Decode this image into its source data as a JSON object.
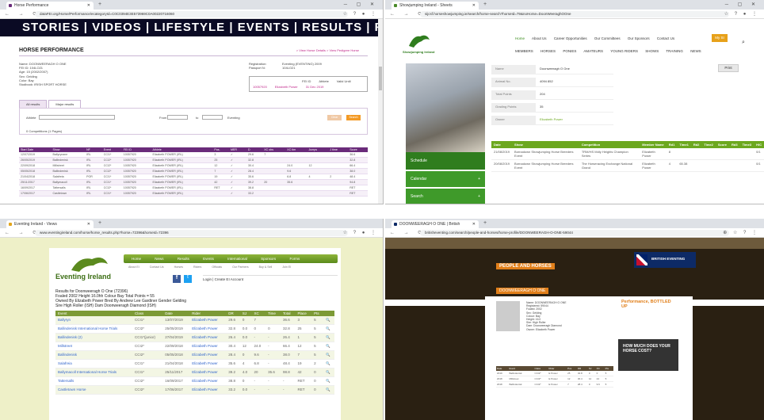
{
  "q1": {
    "tab_title": "Horse Performance",
    "url": "dataFEI.org/Horse/Performance/ecategoryId=C0C0394E3E573969C0A00220716060",
    "banner": "STORIES | VIDEOS | LIFESTYLE | EVENTS | RESULTS | FEI.ORG",
    "page_title": "HORSE PERFORMANCE",
    "links": "> View Horse Details    > View Pedigree Horse",
    "info_left": [
      "Name: DOONWEERAGH O ONE",
      "FEI ID: 104LO21",
      "Age: 15 (2002/2007)",
      "Sex: Gelding",
      "Color: Bay",
      "Studbook: IRISH SPORT HORSE"
    ],
    "info_right_labels": [
      "Registration:",
      "Passport N:"
    ],
    "info_right_values": [
      "Eventing (EVENTING) 2009",
      "104LO21"
    ],
    "box_labels": [
      "FEI ID",
      "Athlete",
      "Valid Until"
    ],
    "box_values": [
      "10057920",
      "Elizabeth Power",
      "31 Dec 2019"
    ],
    "tabs": [
      "All results",
      "Major results"
    ],
    "filter_label": "Athlete",
    "from_label": "From",
    "to_label": "to",
    "checkbox_label": "Eventing",
    "search_btn": "Search",
    "clear_btn": "Clear",
    "results_count": "0 Competitions (1 Pages)",
    "headers": [
      "Start Date",
      "Show",
      "NF",
      "Event",
      "FEI ID",
      "Athlete",
      "Pos.",
      "MER",
      "D",
      "XC obs",
      "XC tim",
      "Jumps",
      "J time",
      "Score"
    ],
    "rows": [
      [
        "12/07/2019",
        "Ballyrynane",
        "IRL",
        "CCI1*",
        "10057920",
        "Elizabeth POWER (IRL)",
        "3",
        "✓",
        "29.6",
        "7",
        "",
        "",
        "",
        "36.6"
      ],
      [
        "26/05/2019",
        "Ballindenisk",
        "IRL",
        "CCI2*",
        "10057920",
        "Elizabeth POWER (IRL)",
        "25",
        "✓",
        "32.8",
        "",
        "",
        "",
        "",
        "32.8"
      ],
      [
        "22/09/2018",
        "Millstreet",
        "IRL",
        "CCI2*",
        "10057920",
        "Elizabeth POWER (IRL)",
        "12",
        "✓",
        "30.4",
        "",
        "24.0",
        "12",
        "",
        "66.4"
      ],
      [
        "05/05/2018",
        "Ballindenisk",
        "IRL",
        "CCI2*",
        "10057920",
        "Elizabeth POWER (IRL)",
        "7",
        "✓",
        "28.4",
        "",
        "9.6",
        "",
        "",
        "38.0"
      ],
      [
        "21/04/2018",
        "Salafreia",
        "POR",
        "CCI1*",
        "10057920",
        "Elizabeth POWER (IRL)",
        "19",
        "✓",
        "35.6",
        "",
        "6.8",
        "4",
        "2",
        "48.4"
      ],
      [
        "25/11/2017",
        "Ballymacoll",
        "IRL",
        "CCI1*",
        "10057920",
        "Elizabeth POWER (IRL)",
        "42",
        "✓",
        "39.2",
        "20",
        "35.6",
        "",
        "",
        "94.8"
      ],
      [
        "16/09/2017",
        "Tattersalls",
        "IRL",
        "CCI2*",
        "10057920",
        "Elizabeth POWER (IRL)",
        "RET",
        "✓",
        "38.8",
        "",
        "",
        "",
        "",
        "RET"
      ],
      [
        "17/06/2017",
        "Castletown",
        "IRL",
        "CCI1*",
        "10057920",
        "Elizabeth POWER (IRL)",
        "",
        "✓",
        "33.2",
        "",
        "",
        "",
        "",
        "RET"
      ]
    ]
  },
  "q2": {
    "tab_title": "Showjumping Ireland - Sheets",
    "url": "sijcsf.horseshowjumping.ie/search/horse-search?horseId=79&noHorse=DoonWeeraghOOne",
    "logo_text": "Showjumping Ireland",
    "nav_top": [
      "Home",
      "About Us",
      "Career Opportunities",
      "Our Committees",
      "Our Sponsors",
      "Contact Us"
    ],
    "my_si": "My SI",
    "nav_main": [
      "MEMBERS",
      "HORSES",
      "PONIES",
      "AMATEURS",
      "YOUNG RIDERS",
      "SHOWS",
      "TRAINING",
      "NEWS"
    ],
    "sidebar": [
      "Schedule",
      "Calendar",
      "Search"
    ],
    "fields": [
      {
        "label": "Name",
        "value": "Doonweeragh O One"
      },
      {
        "label": "Animal No.",
        "value": "4094 852"
      },
      {
        "label": "Total Points",
        "value": "204"
      },
      {
        "label": "Grading Points",
        "value": "35"
      },
      {
        "label": "Owner",
        "value": "Elizabeth Power"
      }
    ],
    "print": "Print",
    "headers": [
      "Date",
      "Show",
      "Competition",
      "Member Name",
      "Rd1",
      "Time1",
      "Rd2",
      "Time2",
      "Score",
      "Rd3",
      "Time3",
      "H/C"
    ],
    "rows": [
      [
        "21/08/2019",
        "Bornadown Showjumping Horse Breeders Event",
        "TRM/HS Mdly Heights Champion Series",
        "Elizabeth Power",
        "8",
        "",
        "",
        "",
        "",
        "",
        "",
        "0/1"
      ],
      [
        "20/08/2019",
        "Bornadown Showjumping Horse Breeders Event",
        "The Horseracing Exchange National Grand",
        "Elizabeth Power",
        "4",
        "65.38",
        "",
        "",
        "",
        "",
        "",
        "0/1"
      ]
    ]
  },
  "q3": {
    "tab_title": "Eventing Ireland - Views",
    "url": "www.eventingireland.com/horse/horse_results.php?horse=72396&horseId=72396",
    "logo_text": "Eventing Ireland",
    "nav": [
      "Home",
      "News",
      "Results",
      "Events",
      "International",
      "Sponsors",
      "Forms"
    ],
    "subnav": [
      "About EI",
      "Contact Us",
      "Horses",
      "Riders",
      "Officials",
      "Our Partners",
      "Buy & Sell",
      "Join EI"
    ],
    "login": "Login   |   Create EI Account",
    "results_lines": [
      "Results for Doonweeragh O One (72396)",
      "Foaled 2002 Height 16.0hh Colour Bay Total Points = 55",
      "Owned By Elizabeth Power Bred By Andrew Lee Gardiner Gender Gelding",
      "Sire High Roller (ISH) Dam Doonweeragh Diamond (ISH)"
    ],
    "headers": [
      "Event",
      "Class",
      "Date",
      "Rider",
      "DR",
      "SJ",
      "XC",
      "Time",
      "Total",
      "Place",
      "Pts",
      ""
    ],
    "rows": [
      [
        "Ballyryn",
        "CCI1*",
        "13/07/2019",
        "Elizabeth Power",
        "29.6",
        "0",
        "7",
        "",
        "36.6",
        "3",
        "5",
        "🔍"
      ],
      [
        "Ballindenisk International Horse Trials",
        "CCI2*",
        "25/05/2019",
        "Elizabeth Power",
        "32.8",
        "0.0",
        "0",
        "0",
        "32.8",
        "25",
        "5",
        "🔍"
      ],
      [
        "Ballindenisk (2)",
        "CCI1*(junior)",
        "27/04/2019",
        "Elizabeth Power",
        "26.4",
        "0.0",
        "-",
        "-",
        "26.4",
        "1",
        "5",
        "🔍"
      ],
      [
        "Millstreet",
        "CCI2*",
        "22/09/2018",
        "Elizabeth Power",
        "30.4",
        "12",
        "24.0",
        "-",
        "66.4",
        "12",
        "5",
        "🔍"
      ],
      [
        "Ballindenisk",
        "CCI2*",
        "05/05/2018",
        "Elizabeth Power",
        "28.4",
        "0",
        "9.6",
        "-",
        "38.0",
        "7",
        "5",
        "🔍"
      ],
      [
        "Salafreia",
        "CCI1*",
        "21/04/2018",
        "Elizabeth Power",
        "35.6",
        "4",
        "6.8",
        "-",
        "48.4",
        "19",
        "2",
        "🔍"
      ],
      [
        "Ballymacoll International Horse Trials",
        "CCI1*",
        "25/11/2017",
        "Elizabeth Power",
        "39.2",
        "4.0",
        "20",
        "35.6",
        "98.8",
        "42",
        "0",
        "🔍"
      ],
      [
        "Tattersalls",
        "CCI2*",
        "16/09/2017",
        "Elizabeth Power",
        "38.8",
        "0",
        "-",
        "-",
        "-",
        "RET",
        "0",
        "🔍"
      ],
      [
        "Castletown Horse",
        "CCI2*",
        "17/06/2017",
        "Elizabeth Power",
        "33.2",
        "0.0",
        "-",
        "-",
        "-",
        "RET",
        "0",
        "🔍"
      ]
    ]
  },
  "q4": {
    "tab_title": "DOONWEERAGH O ONE | British",
    "url": "britisheventing.com/search/people-and-horses/horse-profile/DOONWEERAGH-O-ONE-59044",
    "section_title": "PEOPLE AND HORSES",
    "horse_name": "DOONWEERAGH O ONE",
    "brand": "BRITISH EVENTING",
    "ad1": "Performance, BOTTLED UP",
    "ad2": "HOW MUCH DOES YOUR HORSE COST?",
    "details": [
      "Name: DOONWEERAGH O ONE",
      "Registered: 59044",
      "Foaled: 2002",
      "Sex: Gelding",
      "Colour: Bay",
      "Height: 16.0",
      "Sire: High Roller",
      "Dam: Doonweeragh Diamond",
      "Owner: Elizabeth Power"
    ],
    "headers": [
      "Date",
      "Event",
      "Class",
      "Rider",
      "Pos",
      "DR",
      "SJ",
      "XC",
      "Pts"
    ],
    "rows": [
      [
        "2019",
        "Ballindenisk",
        "CCI2*",
        "E Power",
        "25",
        "32.8",
        "0",
        "0",
        "5"
      ],
      [
        "2018",
        "Millstreet",
        "CCI2*",
        "E Power",
        "12",
        "30.4",
        "12",
        "24",
        "5"
      ],
      [
        "2018",
        "Ballindenisk",
        "CCI2*",
        "E Power",
        "7",
        "28.4",
        "0",
        "9.6",
        "5"
      ]
    ]
  }
}
